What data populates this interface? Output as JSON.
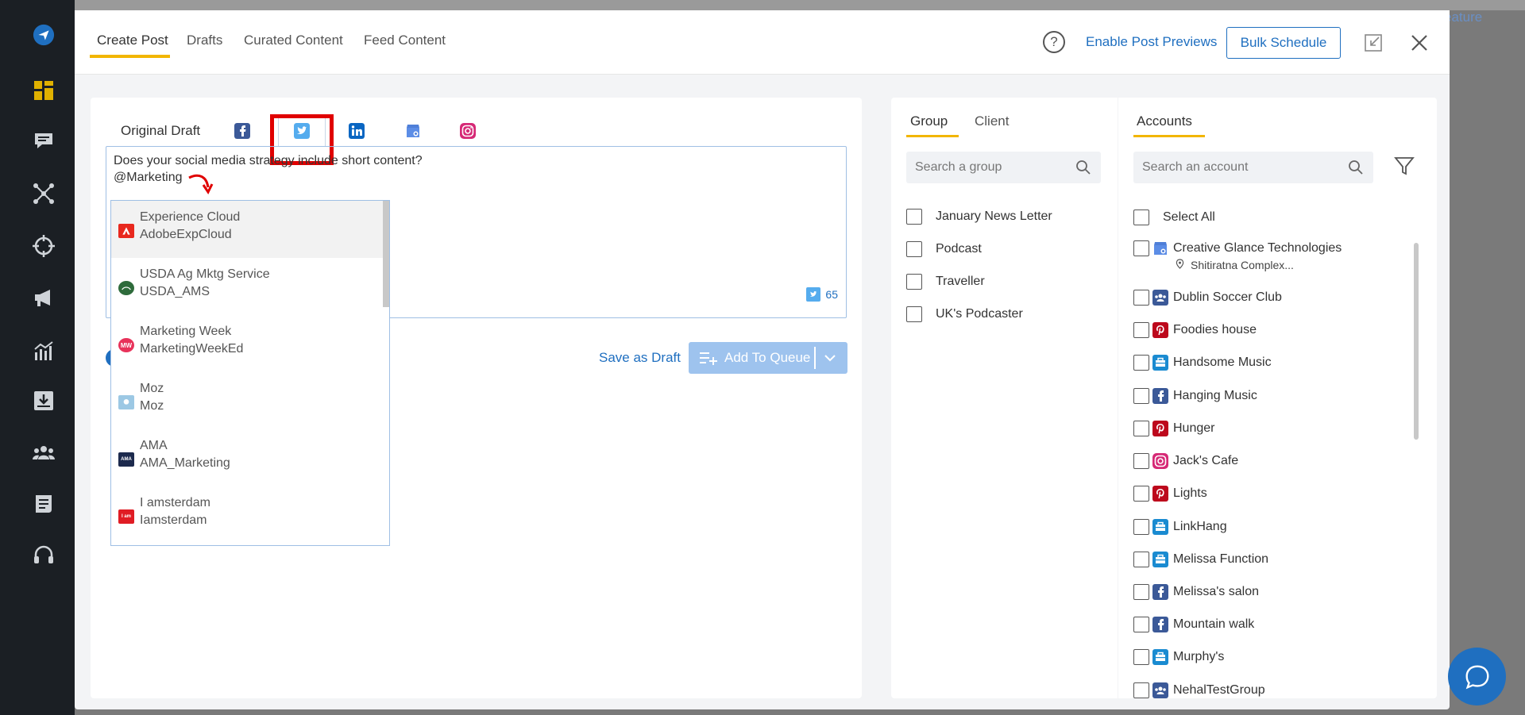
{
  "backdrop": {
    "feature_link": "eature"
  },
  "header": {
    "tabs": [
      "Create Post",
      "Drafts",
      "Curated Content",
      "Feed Content"
    ],
    "enable_previews": "Enable Post Previews",
    "bulk_schedule": "Bulk Schedule",
    "help": "?"
  },
  "compose": {
    "original_draft": "Original Draft",
    "network_tabs": [
      "facebook-icon",
      "twitter-icon",
      "linkedin-icon",
      "google-business-icon",
      "instagram-icon"
    ],
    "text_line1": "Does your social media strategy include short content?",
    "text_line2": "@Marketing",
    "char_count": "65",
    "save_as_draft": "Save as Draft",
    "add_to_queue": "Add To Queue"
  },
  "mentions": [
    {
      "name": "Experience Cloud",
      "handle": "AdobeExpCloud",
      "logo_color": "#e8281e",
      "logo_text": "A"
    },
    {
      "name": "USDA Ag Mktg Service",
      "handle": "USDA_AMS",
      "logo_color": "#2e6b3b",
      "logo_text": ""
    },
    {
      "name": "Marketing Week",
      "handle": "MarketingWeekEd",
      "logo_color": "#e8325a",
      "logo_text": "MW"
    },
    {
      "name": "Moz",
      "handle": "Moz",
      "logo_color": "#9cc8e4",
      "logo_text": ""
    },
    {
      "name": "AMA",
      "handle": "AMA_Marketing",
      "logo_color": "#1d2a4d",
      "logo_text": "AMA"
    },
    {
      "name": "I amsterdam",
      "handle": "Iamsterdam",
      "logo_color": "#e01c24",
      "logo_text": "I am"
    }
  ],
  "groups": {
    "tabs": [
      "Group",
      "Client"
    ],
    "search_placeholder": "Search a group",
    "items": [
      "January News Letter",
      "Podcast",
      "Traveller",
      "UK's Podcaster"
    ]
  },
  "accounts": {
    "tab": "Accounts",
    "search_placeholder": "Search an account",
    "select_all": "Select All",
    "items": [
      {
        "name": "Creative Glance Technologies",
        "type": "gmb",
        "sub": "Shitiratna Complex..."
      },
      {
        "name": "Dublin Soccer Club",
        "type": "fbgroup"
      },
      {
        "name": "Foodies house",
        "type": "pinterest"
      },
      {
        "name": "Handsome Music",
        "type": "business"
      },
      {
        "name": "Hanging Music",
        "type": "facebook"
      },
      {
        "name": "Hunger",
        "type": "pinterest"
      },
      {
        "name": "Jack's Cafe",
        "type": "instagram"
      },
      {
        "name": "Lights",
        "type": "pinterest"
      },
      {
        "name": "LinkHang",
        "type": "business"
      },
      {
        "name": "Melissa Function",
        "type": "business"
      },
      {
        "name": "Melissa's salon",
        "type": "facebook"
      },
      {
        "name": "Mountain walk",
        "type": "facebook"
      },
      {
        "name": "Murphy's",
        "type": "business"
      },
      {
        "name": "NehalTestGroup",
        "type": "fbgroup"
      }
    ]
  },
  "colors": {
    "accent": "#1f6fc0",
    "underline": "#f2b600",
    "highlight_box": "#e00000",
    "facebook": "#3b5998",
    "twitter": "#55acee",
    "linkedin": "#0a66c2",
    "pinterest": "#bd081c",
    "business": "#1a8bd1"
  }
}
